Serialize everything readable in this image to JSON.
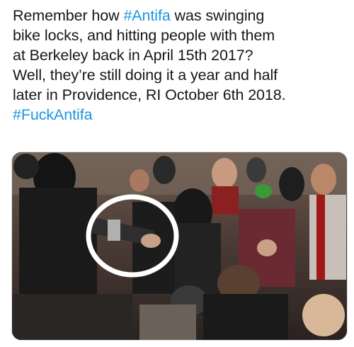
{
  "tweet": {
    "lines": [
      {
        "pre": "Remember how ",
        "tag": "#Antifa",
        "post": " was swinging"
      },
      {
        "pre": "bike locks, and hitting people with them",
        "tag": "",
        "post": ""
      },
      {
        "pre": "at Berkeley back in April 15th 2017?",
        "tag": "",
        "post": ""
      },
      {
        "pre": "Well, they’re still doing it a year and half",
        "tag": "",
        "post": ""
      },
      {
        "pre": "later in Providence, RI October 6th 2018.",
        "tag": "",
        "post": ""
      },
      {
        "pre": "",
        "tag": "#FuckAntifa",
        "post": ""
      }
    ],
    "hashtag_color": "#1b95e0",
    "text_color": "#14171a"
  },
  "media": {
    "description_icon": "photo",
    "highlight_color": "#ffffff"
  }
}
